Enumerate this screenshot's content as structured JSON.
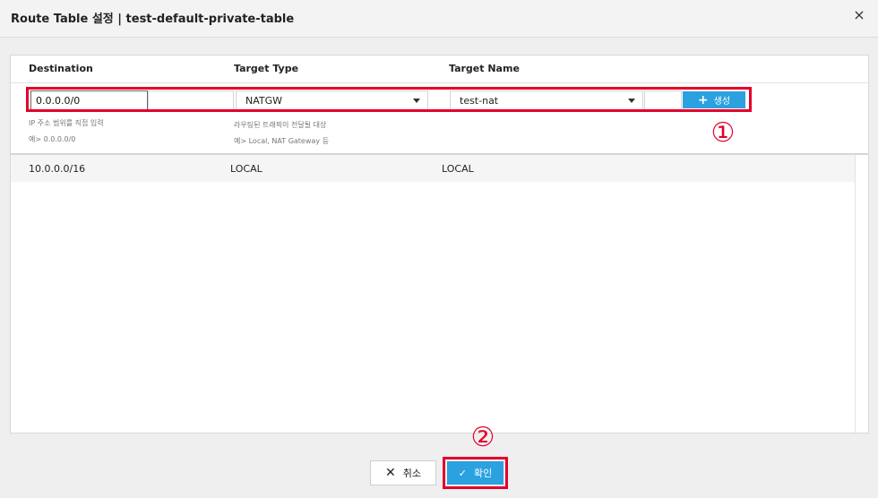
{
  "dialog": {
    "title": "Route Table 설정 | test-default-private-table",
    "close_icon": "×"
  },
  "columns": {
    "destination": "Destination",
    "target_type": "Target Type",
    "target_name": "Target Name"
  },
  "form": {
    "destination_value": "0.0.0.0/0",
    "target_type_selected": "NATGW",
    "target_name_selected": "test-nat",
    "create_label": "생성",
    "create_icon": "+",
    "hint_dest_1": "IP 주소 범위를 직접 입력",
    "hint_dest_2": "예> 0.0.0.0/0",
    "hint_type_1": "라우팅된 트래픽이 전달될 대상",
    "hint_type_2": "예> Local, NAT Gateway 등"
  },
  "routes": [
    {
      "destination": "10.0.0.0/16",
      "target_type": "LOCAL",
      "target_name": "LOCAL"
    }
  ],
  "annotations": {
    "step1": "①",
    "step2": "②",
    "highlight_color": "#e4002b"
  },
  "footer": {
    "cancel_label": "취소",
    "cancel_icon": "✕",
    "ok_label": "확인",
    "ok_icon": "✓"
  },
  "colors": {
    "accent": "#2ba1e0"
  }
}
